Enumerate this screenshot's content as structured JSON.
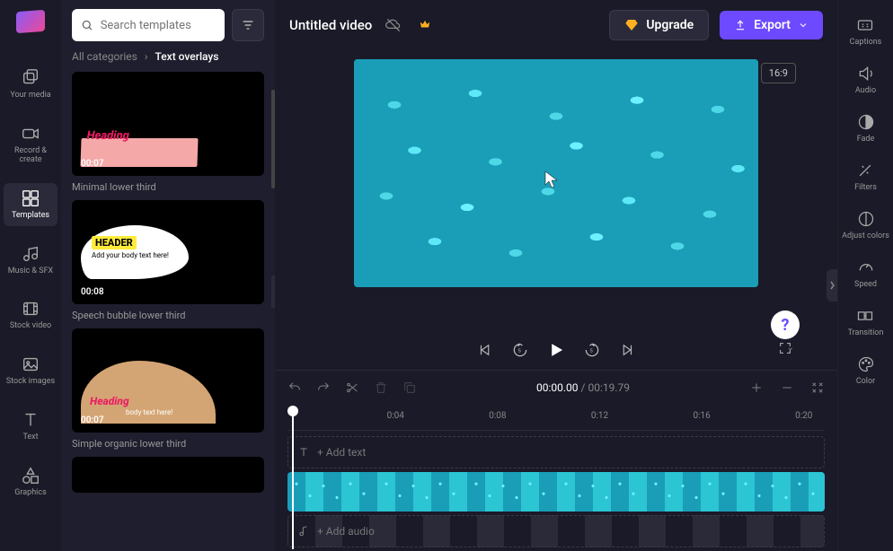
{
  "leftRail": {
    "items": [
      {
        "label": "Your media"
      },
      {
        "label": "Record & create"
      },
      {
        "label": "Templates"
      },
      {
        "label": "Music & SFX"
      },
      {
        "label": "Stock video"
      },
      {
        "label": "Stock images"
      },
      {
        "label": "Text"
      },
      {
        "label": "Graphics"
      }
    ]
  },
  "sidePanel": {
    "searchPlaceholder": "Search templates",
    "breadcrumbParent": "All categories",
    "breadcrumbCurrent": "Text overlays",
    "templates": [
      {
        "title": "Minimal lower third",
        "heading": "Heading",
        "duration": "00:07"
      },
      {
        "title": "Speech bubble lower third",
        "header": "HEADER",
        "body": "Add your body text here!",
        "duration": "00:08"
      },
      {
        "title": "Simple organic lower third",
        "heading": "Heading",
        "body": "body text here!",
        "duration": "00:07"
      }
    ]
  },
  "topbar": {
    "title": "Untitled video",
    "upgradeLabel": "Upgrade",
    "exportLabel": "Export"
  },
  "preview": {
    "aspect": "16:9"
  },
  "timeline": {
    "currentTime": "00:00.00",
    "totalTime": "00:19.79",
    "ticks": [
      "0:04",
      "0:08",
      "0:12",
      "0:16",
      "0:20"
    ],
    "addTextLabel": "+ Add text",
    "addAudioLabel": "+ Add audio"
  },
  "rightRail": {
    "items": [
      {
        "label": "Captions"
      },
      {
        "label": "Audio"
      },
      {
        "label": "Fade"
      },
      {
        "label": "Filters"
      },
      {
        "label": "Adjust colors"
      },
      {
        "label": "Speed"
      },
      {
        "label": "Transition"
      },
      {
        "label": "Color"
      }
    ]
  },
  "help": {
    "glyph": "?"
  }
}
